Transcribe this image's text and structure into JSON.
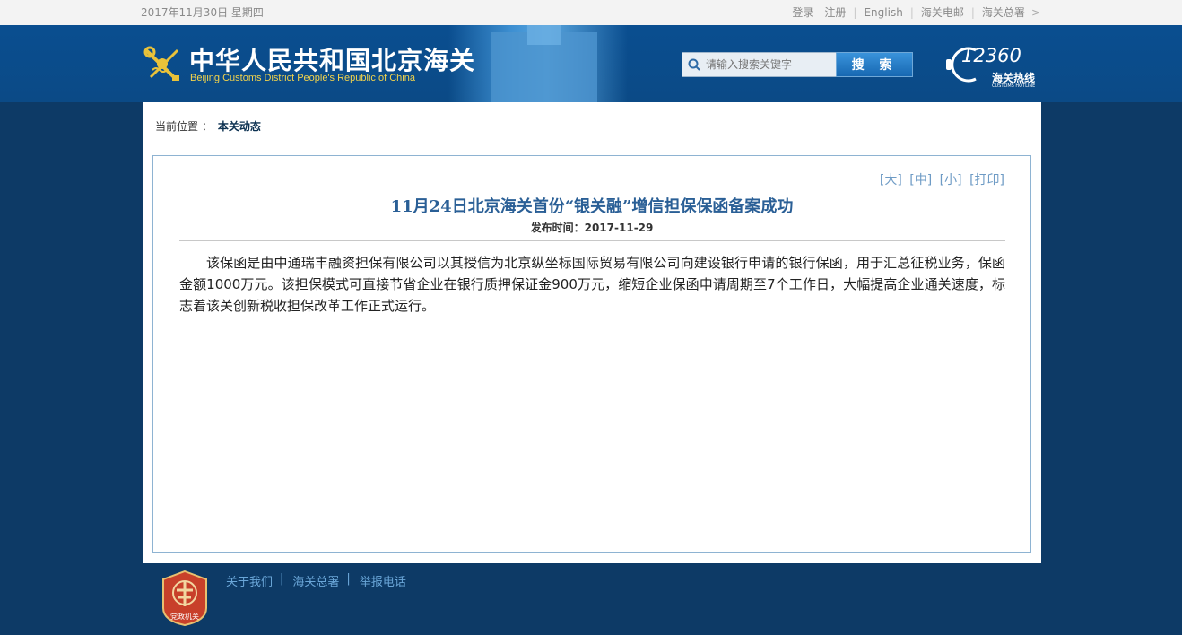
{
  "topbar": {
    "date": "2017年11月30日 星期四",
    "links": {
      "login": "登录",
      "register": "注册",
      "english": "English",
      "mail": "海关电邮",
      "gac": "海关总署"
    },
    "arrow": ">"
  },
  "header": {
    "title_cn": "中华人民共和国北京海关",
    "title_en": "Beijing Customs District People's Republic of China",
    "search_placeholder": "请输入搜索关键字",
    "search_button": "搜 索",
    "hotline_number": "12360",
    "hotline_cn": "海关热线",
    "hotline_en": "CUSTOMS HOTLINE"
  },
  "breadcrumb": {
    "label": "当前位置 ：",
    "current": "本关动态"
  },
  "article": {
    "tools": {
      "large": "[大]",
      "medium": "[中]",
      "small": "[小]",
      "print": "[打印]"
    },
    "title": "11月24日北京海关首份“银关融”增信担保保函备案成功",
    "pubdate": "发布时间：2017-11-29",
    "body": "该保函是由中通瑞丰融资担保有限公司以其授信为北京纵坐标国际贸易有限公司向建设银行申请的银行保函，用于汇总征税业务，保函金额1000万元。该担保模式可直接节省企业在银行质押保证金900万元，缩短企业保函申请周期至7个工作日，大幅提高企业通关速度，标志着该关创新税收担保改革工作正式运行。"
  },
  "footer": {
    "links": {
      "about": "关于我们",
      "gac": "海关总署",
      "report": "举报电话"
    },
    "badge": "党政机关"
  },
  "colors": {
    "background": "#0d3a66",
    "header": "#0b4a86",
    "title_accent": "#2a5f96",
    "link": "#6aa6d8"
  }
}
